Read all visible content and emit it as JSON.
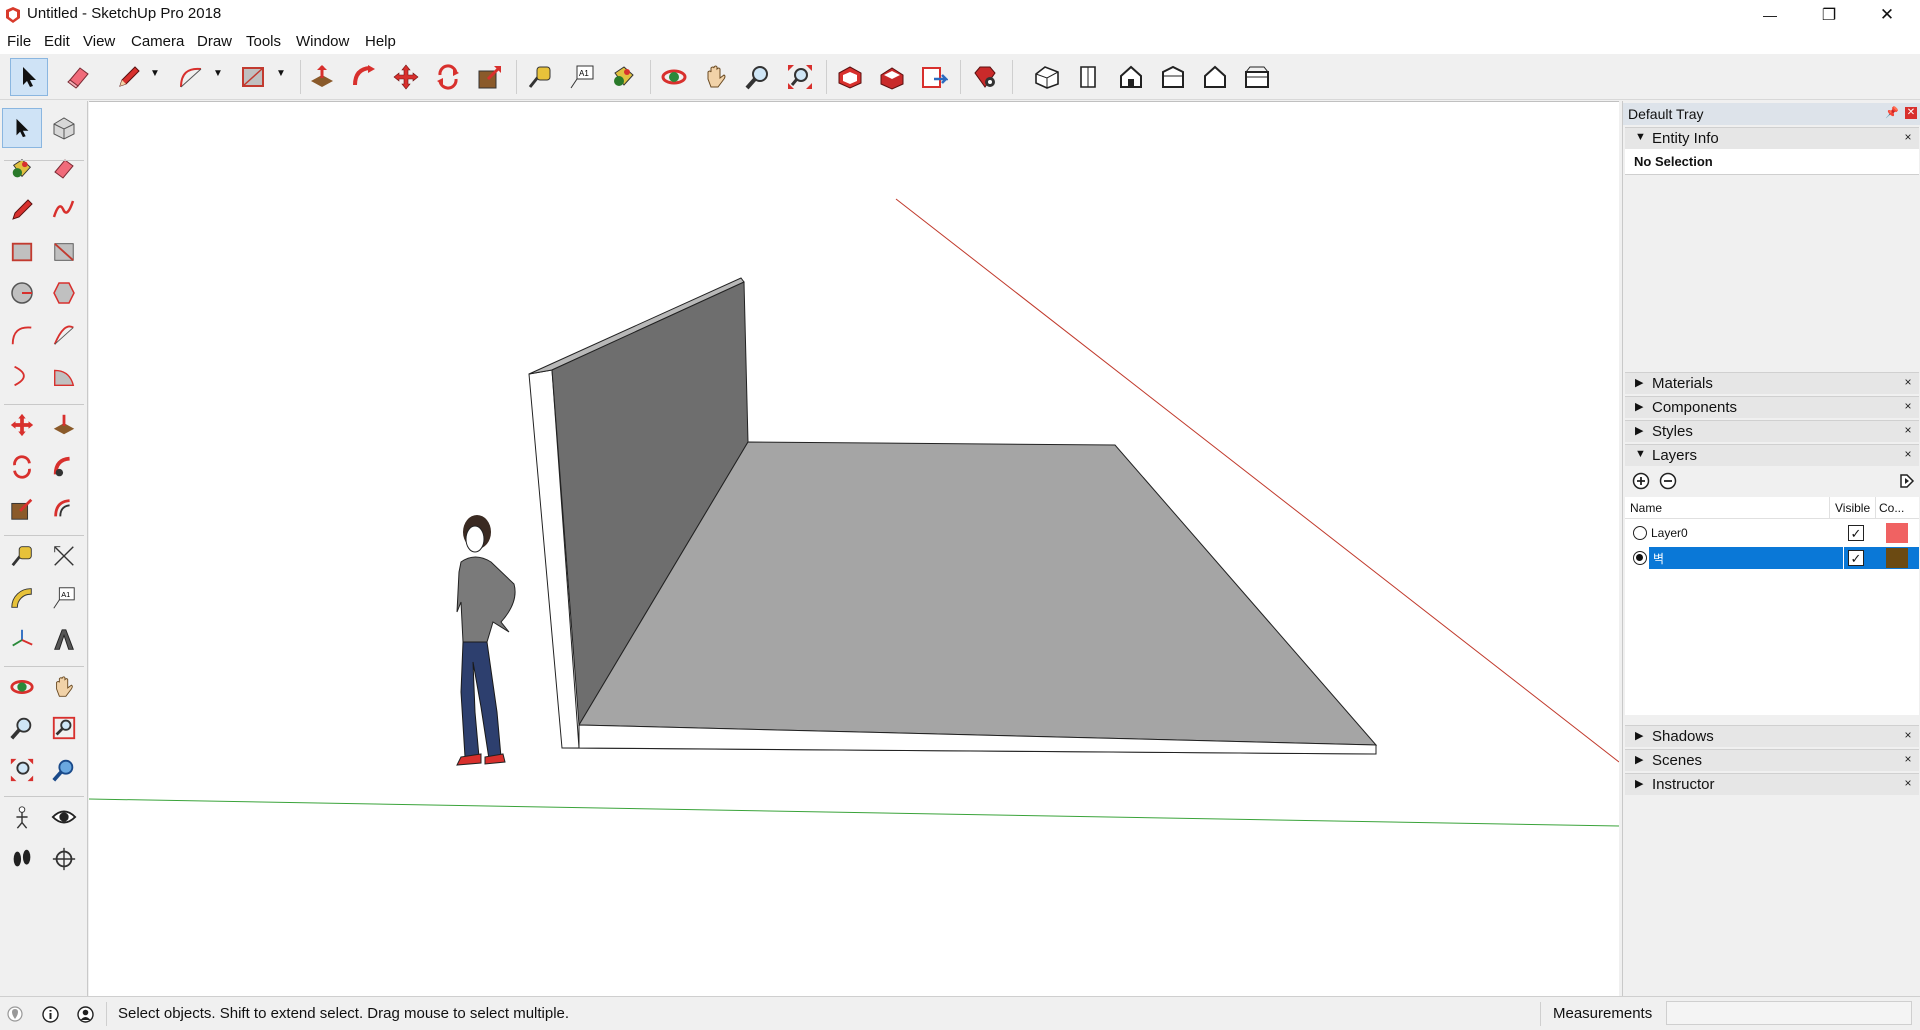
{
  "window": {
    "title": "Untitled - SketchUp Pro 2018",
    "minimize_glyph": "—",
    "maximize_glyph": "❐",
    "close_glyph": "✕"
  },
  "menu": [
    "File",
    "Edit",
    "View",
    "Camera",
    "Draw",
    "Tools",
    "Window",
    "Help"
  ],
  "toolbar_icons": [
    "select-icon",
    "eraser-icon",
    "pencil-icon",
    "arc-icon",
    "rectangle-icon",
    "push-pull-icon",
    "offset-icon",
    "move-icon",
    "rotate-icon",
    "scale-icon",
    "tape-measure-icon",
    "text-icon",
    "paint-bucket-icon",
    "orbit-icon",
    "pan-icon",
    "zoom-icon",
    "zoom-extents-icon",
    "3d-warehouse-icon",
    "extension-warehouse-icon",
    "layout-icon",
    "extension-manager-icon",
    "iso-view-icon",
    "top-view-icon",
    "front-view-icon",
    "right-view-icon",
    "back-view-icon",
    "left-view-icon"
  ],
  "tray": {
    "title": "Default Tray",
    "entity_info": {
      "label": "Entity Info",
      "status": "No Selection"
    },
    "panels_mid": [
      "Materials",
      "Components",
      "Styles"
    ],
    "layers": {
      "label": "Layers",
      "columns": {
        "name": "Name",
        "visible": "Visible",
        "color": "Co..."
      },
      "rows": [
        {
          "name": "Layer0",
          "visible": true,
          "color": "#f06262",
          "active": false
        },
        {
          "name": "벽",
          "visible": true,
          "color": "#6b4a12",
          "active": true
        }
      ]
    },
    "panels_bottom": [
      "Shadows",
      "Scenes",
      "Instructor"
    ]
  },
  "status": {
    "message": "Select objects. Shift to extend select. Drag mouse to select multiple.",
    "measurements_label": "Measurements",
    "measurements_value": ""
  },
  "colors": {
    "selection": "#0a78d7",
    "wall": "#6e6e6e",
    "floor": "#a5a5a5",
    "axis_red": "#c0392b",
    "axis_green": "#3aa33a"
  }
}
